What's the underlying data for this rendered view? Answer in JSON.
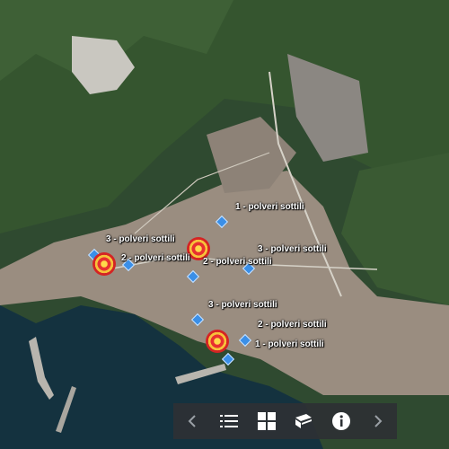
{
  "map": {
    "labels": {
      "l1": "1 - polveri sottili",
      "l2": "3 - polveri sottili",
      "l3": "2 - polveri sottili",
      "l4": "2 - polveri sottili",
      "l5": "3 - polveri sottili",
      "l6": "3 - polveri sottili",
      "l7": "2 - polveri sottili",
      "l8": "1 - polveri sottili"
    }
  },
  "toolbar": {
    "items": [
      "prev-arrow-icon",
      "legend-list-icon",
      "grid-layers-icon",
      "basemap-icon",
      "info-icon",
      "next-arrow-icon"
    ]
  },
  "colors": {
    "marker": "#3a8fe8",
    "toolbar": "#2d3034",
    "sea": "#14323f"
  }
}
